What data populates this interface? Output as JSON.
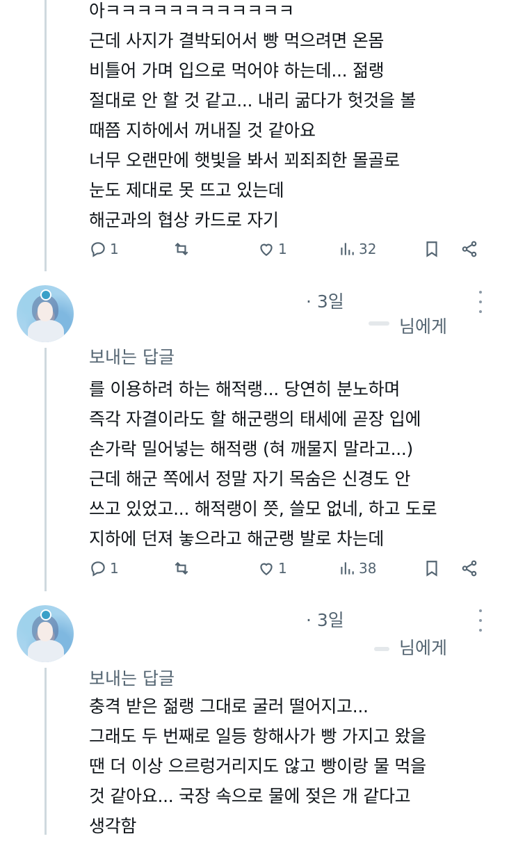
{
  "tweets": [
    {
      "lines": [
        "아ㅋㅋㅋㅋㅋㅋㅋㅋㅋㅋㅋㅋ",
        "근데 사지가 결박되어서 빵 먹으려면 온몸",
        "비틀어 가며 입으로 먹어야 하는데... 젊랭",
        "절대로 안 할 것 같고... 내리 굶다가 헛것을 볼",
        "때쯤 지하에서 꺼내질 것 같아요",
        "너무 오랜만에 햇빛을 봐서 꾀죄죄한 몰골로",
        "눈도 제대로 못 뜨고 있는데",
        "해군과의 협상 카드로 자기"
      ],
      "reply_count": "1",
      "retweet_count": "",
      "like_count": "1",
      "view_count": "32"
    },
    {
      "time": "· 3일",
      "recipient_suffix": "님에게",
      "reply_label": "보내는 답글",
      "lines": [
        "를 이용하려 하는 해적랭... 당연히 분노하며",
        "즉각 자결이라도 할 해군랭의 태세에 곧장 입에",
        "손가락 밀어넣는 해적랭 (혀 깨물지 말라고...)",
        "근데 해군 쪽에서 정말 자기 목숨은 신경도 안",
        "쓰고 있었고... 해적랭이 쯧, 쓸모 없네, 하고 도로",
        "지하에 던져 놓으라고 해군랭 발로 차는데"
      ],
      "reply_count": "1",
      "retweet_count": "",
      "like_count": "1",
      "view_count": "38"
    },
    {
      "time": "· 3일",
      "recipient_suffix": "님에게",
      "reply_label": "보내는 답글",
      "lines": [
        "충격 받은 젊랭 그대로 굴러 떨어지고...",
        "그래도 두 번째로 일등 항해사가 빵 가지고 왔을",
        "땐 더 이상 으르렁거리지도 않고 빵이랑 물 먹을",
        "것 같아요... 국장 속으로 물에 젖은 개 같다고",
        "생각함"
      ]
    }
  ],
  "icons": {
    "reply": "reply-icon",
    "retweet": "retweet-icon",
    "like": "heart-icon",
    "views": "views-icon",
    "bookmark": "bookmark-icon",
    "share": "share-icon",
    "more": "more-icon"
  },
  "colors": {
    "text": "#0f1419",
    "secondary": "#536471",
    "thread_line": "#cfd9de"
  }
}
